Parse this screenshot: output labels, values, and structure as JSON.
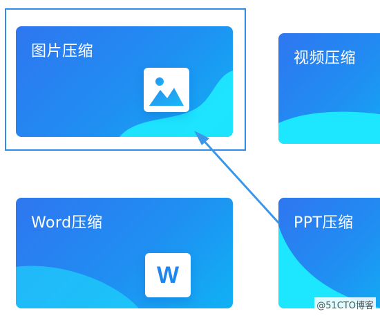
{
  "cards": {
    "image_compress": {
      "title": "图片压缩"
    },
    "video_compress": {
      "title": "视频压缩"
    },
    "word_compress": {
      "title": "Word压缩",
      "icon_letter": "W"
    },
    "ppt_compress": {
      "title": "PPT压缩"
    }
  },
  "watermark": "@51CTO博客",
  "colors": {
    "card_start": "#2f76f0",
    "card_end": "#10b1f4",
    "wave_cyan": "#1de7ff",
    "highlight_border": "#2f8de8",
    "arrow": "#3a96e8"
  },
  "icons": {
    "image_compress": "image-icon",
    "word_compress": "word-document-icon"
  }
}
